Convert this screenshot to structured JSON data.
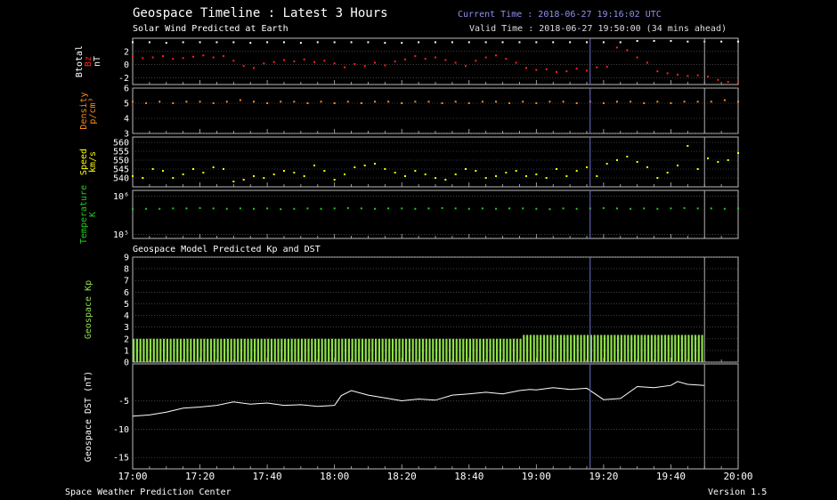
{
  "header": {
    "title": "Geospace Timeline : Latest 3 Hours",
    "subtitle": "Solar Wind Predicted at Earth",
    "current_time": "Current Time : 2018-06-27 19:16:02 UTC",
    "valid_time": "Valid Time : 2018-06-27 19:50:00 (34 mins ahead)",
    "model_subtitle": "Geospace Model Predicted Kp and DST"
  },
  "footer": {
    "left": "Space Weather Prediction Center",
    "right": "Version 1.5"
  },
  "colors": {
    "btotal": "#ffffff",
    "bz": "#ff2020",
    "density": "#ff8c1a",
    "speed": "#ffff00",
    "temperature": "#22cc22",
    "kp": "#8fe04a",
    "dst": "#ffffff",
    "current_line": "#7070d0",
    "valid_line": "#b0b0b0",
    "grid": "#666666"
  },
  "chart_data": [
    {
      "id": "mag",
      "type": "scatter",
      "ylabel_lines": [
        "Btotal",
        "Bz",
        "nT"
      ],
      "ylim": [
        -3,
        4
      ],
      "yticks": [
        2,
        0,
        -2
      ],
      "x_range": [
        "17:00",
        "20:00"
      ],
      "series": [
        {
          "name": "Btotal",
          "x": [
            0,
            5,
            10,
            15,
            20,
            25,
            30,
            35,
            40,
            45,
            50,
            55,
            60,
            65,
            70,
            75,
            80,
            85,
            90,
            95,
            100,
            105,
            110,
            115,
            120,
            125,
            130,
            135,
            140,
            145,
            150,
            155,
            160,
            165,
            170,
            175,
            180
          ],
          "y": [
            3.4,
            3.4,
            3.3,
            3.4,
            3.4,
            3.4,
            3.4,
            3.3,
            3.4,
            3.4,
            3.3,
            3.4,
            3.4,
            3.4,
            3.4,
            3.3,
            3.3,
            3.4,
            3.4,
            3.4,
            3.4,
            3.4,
            3.4,
            3.4,
            3.4,
            3.4,
            3.4,
            3.4,
            3.4,
            3.4,
            3.6,
            3.6,
            3.6,
            3.5,
            3.5,
            3.5,
            3.5
          ]
        },
        {
          "name": "Bz",
          "x": [
            0,
            3,
            6,
            9,
            12,
            15,
            18,
            21,
            24,
            27,
            30,
            33,
            36,
            39,
            42,
            45,
            48,
            51,
            54,
            57,
            60,
            63,
            66,
            69,
            72,
            75,
            78,
            81,
            84,
            87,
            90,
            93,
            96,
            99,
            102,
            105,
            108,
            111,
            114,
            117,
            120,
            123,
            126,
            129,
            132,
            135,
            138,
            141,
            144,
            147,
            150,
            153,
            156,
            159,
            162,
            165,
            168,
            171,
            174,
            177,
            180
          ],
          "y": [
            1.2,
            1.0,
            1.1,
            1.3,
            0.9,
            1.0,
            1.2,
            1.4,
            1.1,
            1.3,
            0.6,
            -0.2,
            -0.5,
            0.2,
            0.4,
            0.7,
            0.5,
            0.8,
            0.4,
            0.6,
            0.2,
            -0.4,
            0.1,
            -0.2,
            0.3,
            -0.1,
            0.5,
            0.8,
            1.3,
            0.9,
            1.1,
            0.7,
            0.3,
            -0.2,
            0.6,
            1.1,
            1.4,
            0.9,
            0.3,
            -0.5,
            -0.8,
            -0.7,
            -1.1,
            -1.0,
            -0.6,
            -0.9,
            -0.4,
            -0.3,
            2.6,
            2.2,
            1.1,
            0.3,
            -1.0,
            -1.3,
            -1.5,
            -1.7,
            -1.6,
            -1.8,
            -2.3,
            -2.6,
            -2.8
          ]
        }
      ]
    },
    {
      "id": "density",
      "type": "scatter",
      "ylabel_lines": [
        "Density",
        "p/cm³"
      ],
      "ylim": [
        3,
        6
      ],
      "yticks": [
        6,
        5,
        4,
        3
      ],
      "series": [
        {
          "name": "Density",
          "x": [
            0,
            4,
            8,
            12,
            16,
            20,
            24,
            28,
            32,
            36,
            40,
            44,
            48,
            52,
            56,
            60,
            64,
            68,
            72,
            76,
            80,
            84,
            88,
            92,
            96,
            100,
            104,
            108,
            112,
            116,
            120,
            124,
            128,
            132,
            136,
            140,
            144,
            148,
            152,
            156,
            160,
            164,
            168,
            172,
            176,
            180
          ],
          "y": [
            5.1,
            5.0,
            5.1,
            5.0,
            5.1,
            5.1,
            5.0,
            5.1,
            5.2,
            5.1,
            5.0,
            5.1,
            5.1,
            5.0,
            5.1,
            5.0,
            5.1,
            5.0,
            5.1,
            5.1,
            5.0,
            5.1,
            5.1,
            5.0,
            5.1,
            5.0,
            5.1,
            5.1,
            5.0,
            5.1,
            5.0,
            5.1,
            5.1,
            5.0,
            5.1,
            5.0,
            5.1,
            5.1,
            5.0,
            5.1,
            5.0,
            5.1,
            5.1,
            5.1,
            5.2,
            5.1
          ]
        }
      ]
    },
    {
      "id": "speed",
      "type": "scatter",
      "ylabel_lines": [
        "Speed",
        "km/s"
      ],
      "ylim": [
        535,
        563
      ],
      "yticks": [
        560,
        555,
        550,
        545,
        540
      ],
      "series": [
        {
          "name": "Speed",
          "x": [
            0,
            3,
            6,
            9,
            12,
            15,
            18,
            21,
            24,
            27,
            30,
            33,
            36,
            39,
            42,
            45,
            48,
            51,
            54,
            57,
            60,
            63,
            66,
            69,
            72,
            75,
            78,
            81,
            84,
            87,
            90,
            93,
            96,
            99,
            102,
            105,
            108,
            111,
            114,
            117,
            120,
            123,
            126,
            129,
            132,
            135,
            138,
            141,
            144,
            147,
            150,
            153,
            156,
            159,
            162,
            165,
            168,
            171,
            174,
            177,
            180
          ],
          "y": [
            541,
            540,
            545,
            544,
            540,
            542,
            545,
            543,
            546,
            545,
            538,
            539,
            541,
            540,
            542,
            544,
            543,
            541,
            547,
            544,
            539,
            542,
            546,
            547,
            548,
            545,
            543,
            541,
            544,
            542,
            540,
            539,
            542,
            545,
            544,
            540,
            541,
            543,
            544,
            541,
            542,
            540,
            545,
            541,
            544,
            546,
            541,
            548,
            550,
            552,
            549,
            546,
            540,
            543,
            547,
            558,
            545,
            551,
            549,
            550,
            554
          ]
        }
      ]
    },
    {
      "id": "temperature",
      "type": "scatter",
      "ylabel_lines": [
        "Temperature",
        "K"
      ],
      "ylim_log10": [
        4.9,
        6.15
      ],
      "yticks": [
        6,
        5
      ],
      "ytick_labels": [
        "10⁶",
        "10⁵"
      ],
      "series": [
        {
          "name": "Temperature",
          "x": [
            0,
            4,
            8,
            12,
            16,
            20,
            24,
            28,
            32,
            36,
            40,
            44,
            48,
            52,
            56,
            60,
            64,
            68,
            72,
            76,
            80,
            84,
            88,
            92,
            96,
            100,
            104,
            108,
            112,
            116,
            120,
            124,
            128,
            132,
            136,
            140,
            144,
            148,
            152,
            156,
            160,
            164,
            168,
            172,
            176,
            180
          ],
          "y": [
            5.66,
            5.67,
            5.67,
            5.68,
            5.68,
            5.69,
            5.68,
            5.67,
            5.68,
            5.67,
            5.68,
            5.66,
            5.67,
            5.68,
            5.67,
            5.68,
            5.69,
            5.68,
            5.67,
            5.68,
            5.68,
            5.67,
            5.68,
            5.69,
            5.68,
            5.67,
            5.68,
            5.67,
            5.68,
            5.68,
            5.67,
            5.66,
            5.68,
            5.67,
            5.68,
            5.69,
            5.68,
            5.67,
            5.68,
            5.67,
            5.68,
            5.69,
            5.68,
            5.68,
            5.67,
            5.68
          ]
        }
      ]
    },
    {
      "id": "kp",
      "type": "bar",
      "ylabel_lines": [
        "Geospace Kp"
      ],
      "ylim": [
        0,
        9
      ],
      "yticks": [
        0,
        1,
        2,
        3,
        4,
        5,
        6,
        7,
        8,
        9
      ],
      "series": [
        {
          "name": "Kp",
          "segments": [
            {
              "from_min": 0,
              "to_min": 116,
              "value": 2.0
            },
            {
              "from_min": 116,
              "to_min": 170,
              "value": 2.33
            }
          ]
        }
      ]
    },
    {
      "id": "dst",
      "type": "line",
      "ylabel_lines": [
        "Geospace DST (nT)"
      ],
      "ylim": [
        -17,
        1.5
      ],
      "yticks": [
        -5,
        -10,
        -15
      ],
      "series": [
        {
          "name": "DST",
          "x": [
            0,
            5,
            10,
            15,
            20,
            25,
            30,
            35,
            40,
            45,
            50,
            55,
            60,
            62,
            65,
            70,
            75,
            80,
            85,
            90,
            95,
            100,
            105,
            110,
            115,
            118,
            120,
            125,
            130,
            135,
            140,
            145,
            150,
            155,
            160,
            162,
            165,
            170
          ],
          "y": [
            -7.7,
            -7.5,
            -7.0,
            -6.3,
            -6.1,
            -5.8,
            -5.2,
            -5.6,
            -5.4,
            -5.8,
            -5.7,
            -6.0,
            -5.8,
            -4.1,
            -3.2,
            -4.0,
            -4.5,
            -5.0,
            -4.7,
            -4.9,
            -4.0,
            -3.8,
            -3.5,
            -3.8,
            -3.2,
            -3.0,
            -3.1,
            -2.7,
            -3.0,
            -2.8,
            -4.8,
            -4.6,
            -2.5,
            -2.7,
            -2.3,
            -1.6,
            -2.1,
            -2.3
          ]
        }
      ]
    }
  ],
  "x_axis": {
    "ticks": [
      "17:00",
      "17:20",
      "17:40",
      "18:00",
      "18:20",
      "18:40",
      "19:00",
      "19:20",
      "19:40",
      "20:00"
    ],
    "current_minute": 136,
    "valid_minute": 170
  }
}
